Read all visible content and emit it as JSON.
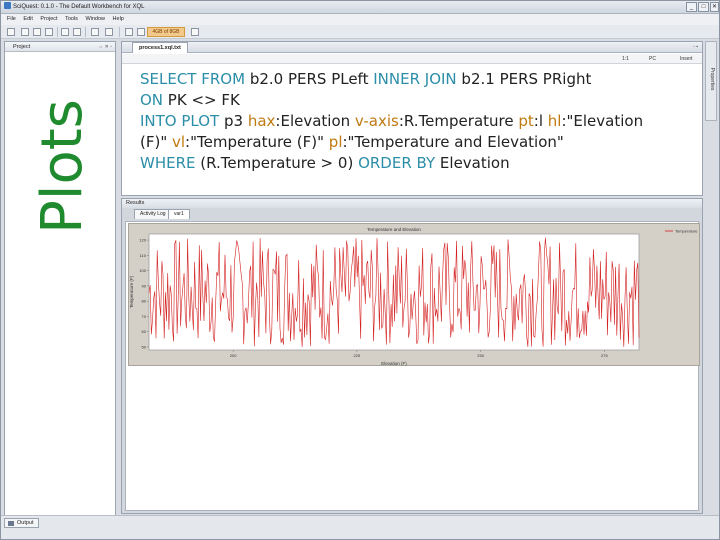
{
  "window": {
    "title": "SciQuest: 0.1.0 - The Default Workbench for XQL",
    "controls": [
      "_",
      "□",
      "✕"
    ]
  },
  "menu": [
    "File",
    "Edit",
    "Project",
    "Tools",
    "Window",
    "Help"
  ],
  "toolbar": {
    "badge": "4GB of 8GB"
  },
  "slide_title": "Plots",
  "project_panel": {
    "tab_label": "Project",
    "controls": "⇔ ✕ ▫"
  },
  "right_strip": {
    "label": "Properties"
  },
  "editor": {
    "tab_label": "process1.xql.txt",
    "tab_controls": "▫ ▪",
    "status": {
      "position": "1:1",
      "mode": "PC",
      "insert": "Insert"
    },
    "query": {
      "l1a": "SELECT FROM",
      "l1b": " b2.0 PERS PLeft ",
      "l1c": "INNER JOIN",
      "l1d": " b2.1 PERS PRight",
      "l2a": "ON",
      "l2b": " PK <> FK",
      "l3a": "INTO PLOT",
      "l3b": " p3 ",
      "l3c": "hax",
      "l3d": ":Elevation ",
      "l3e": "v-axis",
      "l3f": ":R.Temperature ",
      "l3g": "pt",
      "l3h": ":l ",
      "l3i": "hl",
      "l3j": ":\"Elevation",
      "l4a": "(F)\" ",
      "l4b": "vl",
      "l4c": ":\"Temperature (F)\" ",
      "l4d": "pl",
      "l4e": ":\"Temperature and Elevation\"",
      "l5a": "WHERE",
      "l5b": " (R.Temperature > 0) ",
      "l5c": "ORDER BY",
      "l5d": " Elevation"
    }
  },
  "results": {
    "header": "Results",
    "tabs": [
      "Activity Log",
      "var1"
    ]
  },
  "chart_data": {
    "type": "line",
    "title": "Temperature and Elevation",
    "xlabel": "Elevation (F)",
    "ylabel": "Temperature (F)",
    "legend": "Temperature",
    "legend_position": "top-right",
    "x_ticks": [
      "200",
      "225",
      "250",
      "275"
    ],
    "y_ticks": [
      "120",
      "110",
      "100",
      "90",
      "80",
      "70",
      "60",
      "50"
    ],
    "xlim": [
      183,
      282
    ],
    "ylim": [
      48,
      124
    ],
    "line_color": "#d42020",
    "grid": false,
    "note": "dense fluctuating line; y values roughly between 50 and 122 across the full x range"
  },
  "statusbar": {
    "output_tab": "Output"
  }
}
